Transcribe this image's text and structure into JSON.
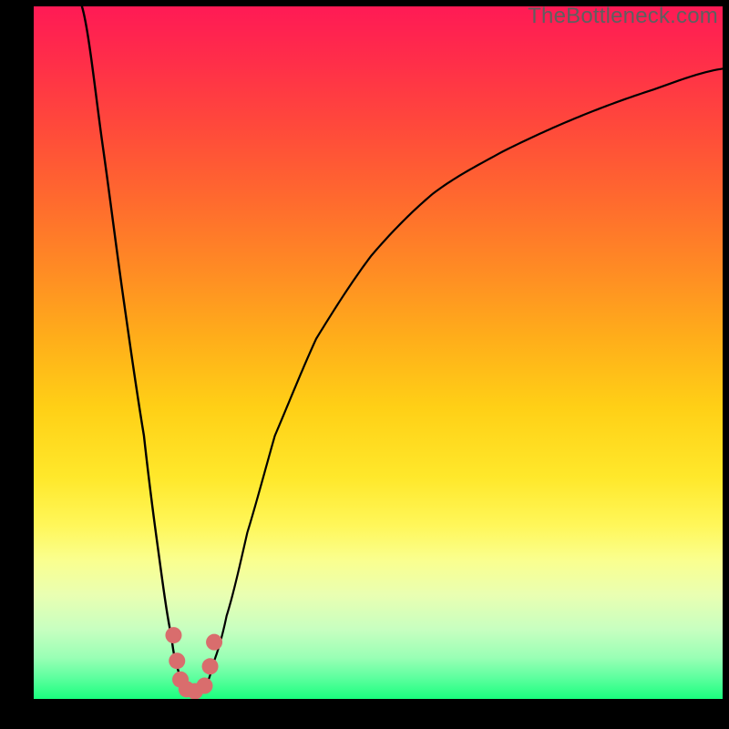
{
  "watermark": "TheBottleneck.com",
  "colors": {
    "frame": "#000000",
    "curve": "#000000",
    "marker": "#d96d6d",
    "gradient_top": "#ff1a55",
    "gradient_bottom": "#1aff7e"
  },
  "chart_data": {
    "type": "line",
    "title": "",
    "xlabel": "",
    "ylabel": "",
    "xlim": [
      0,
      100
    ],
    "ylim": [
      0,
      100
    ],
    "axes_hidden": true,
    "note": "No numeric axis labels are rendered in the image; curve values are pixel-read estimates on a 0-100 normalized scale in each dimension.",
    "series": [
      {
        "name": "left-branch",
        "x": [
          7,
          10,
          13,
          16,
          18,
          20,
          21,
          22,
          23,
          24
        ],
        "y": [
          100,
          80,
          58,
          38,
          22,
          9,
          4,
          2,
          1.2,
          1
        ]
      },
      {
        "name": "right-branch",
        "x": [
          24,
          25,
          26,
          28,
          31,
          35,
          41,
          49,
          58,
          68,
          79,
          90,
          100
        ],
        "y": [
          1,
          2,
          5,
          12,
          24,
          38,
          52,
          64,
          73,
          79,
          84,
          88,
          91
        ]
      }
    ],
    "markers": {
      "name": "pink-dots",
      "points": [
        {
          "x": 20.3,
          "y": 9.2
        },
        {
          "x": 20.8,
          "y": 5.5
        },
        {
          "x": 21.3,
          "y": 2.8
        },
        {
          "x": 22.2,
          "y": 1.4
        },
        {
          "x": 23.4,
          "y": 1.1
        },
        {
          "x": 24.8,
          "y": 1.9
        },
        {
          "x": 25.6,
          "y": 4.7
        },
        {
          "x": 26.2,
          "y": 8.2
        }
      ]
    }
  }
}
